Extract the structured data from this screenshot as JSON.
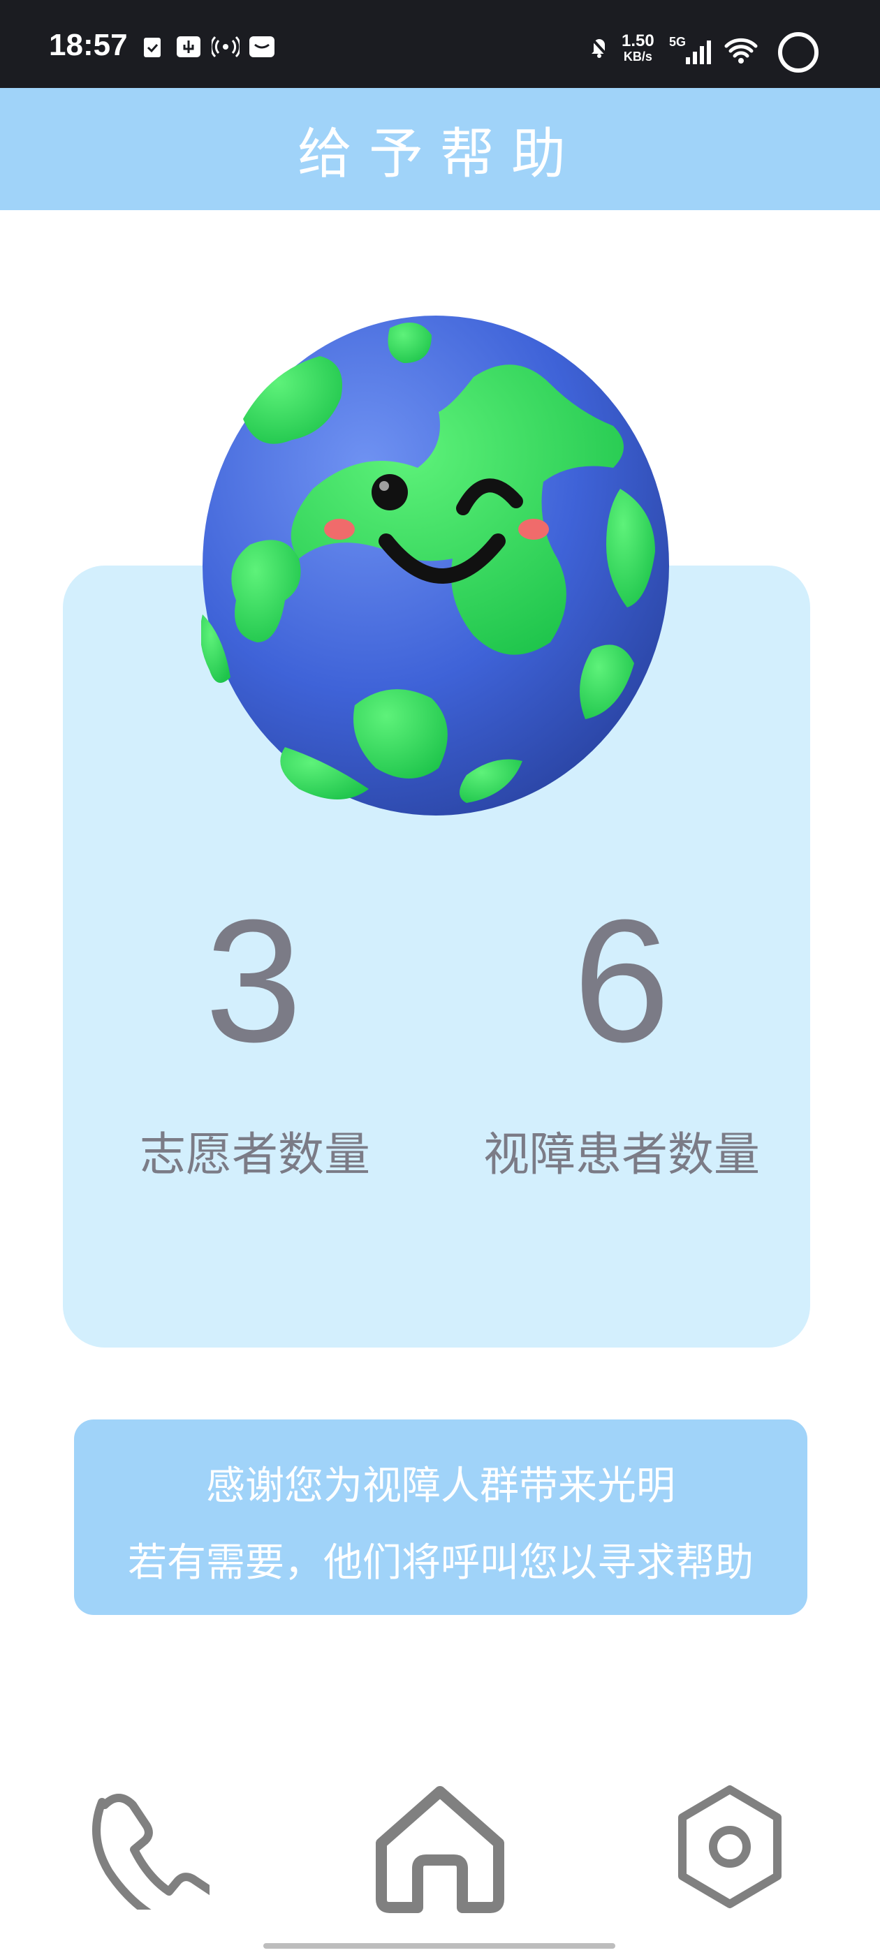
{
  "status_bar": {
    "time": "18:57",
    "speed_value": "1.50",
    "speed_unit": "KB/s",
    "network": "5G"
  },
  "header": {
    "title": "给予帮助"
  },
  "stats": [
    {
      "value": "3",
      "label": "志愿者数量"
    },
    {
      "value": "6",
      "label": "视障患者数量"
    }
  ],
  "banner": {
    "line1": "感谢您为视障人群带来光明",
    "line2": "若有需要，他们将呼叫您以寻求帮助"
  },
  "nav": {
    "items": [
      {
        "icon": "phone-icon"
      },
      {
        "icon": "home-icon"
      },
      {
        "icon": "settings-icon"
      }
    ]
  },
  "colors": {
    "header_bg": "#a0d3f9",
    "card_bg": "#d3effd",
    "text_gray": "#7b7b86",
    "icon_gray": "#808080"
  }
}
